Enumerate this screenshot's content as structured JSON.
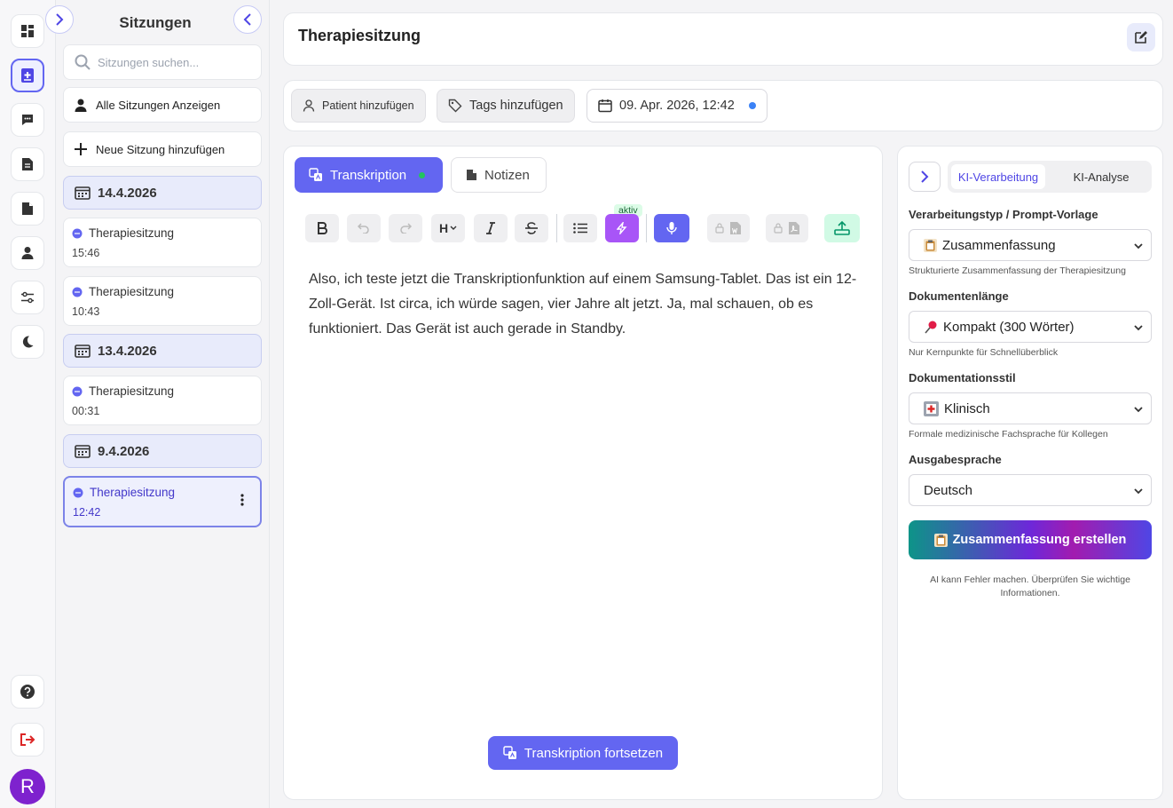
{
  "sidebar": {
    "title": "Sitzungen",
    "search_placeholder": "Sitzungen suchen...",
    "show_all_label": "Alle Sitzungen Anzeigen",
    "add_session_label": "Neue Sitzung hinzufügen",
    "groups": [
      {
        "date": "14.4.2026",
        "items": [
          {
            "title": "Therapiesitzung",
            "time": "15:46"
          },
          {
            "title": "Therapiesitzung",
            "time": "10:43"
          }
        ]
      },
      {
        "date": "13.4.2026",
        "items": [
          {
            "title": "Therapiesitzung",
            "time": "00:31"
          }
        ]
      },
      {
        "date": "9.4.2026",
        "items": [
          {
            "title": "Therapiesitzung",
            "time": "12:42",
            "active": true
          }
        ]
      }
    ]
  },
  "rail": {
    "avatar_letter": "R"
  },
  "header": {
    "title": "Therapiesitzung"
  },
  "meta": {
    "patient_label": "Patient hinzufügen",
    "tags_label": "Tags hinzufügen",
    "date_label": "09. Apr. 2026, 12:42"
  },
  "editor": {
    "tab_transcription": "Transkription",
    "tab_notes": "Notizen",
    "toolbar": {
      "heading_label": "H",
      "aktiv_badge": "aktiv"
    },
    "transcript": "Also, ich teste jetzt die Transkriptionfunktion auf einem Samsung-Tablet. Das ist ein 12-Zoll-Gerät. Ist circa, ich würde sagen, vier Jahre alt jetzt. Ja, mal schauen, ob es funktioniert. Das Gerät ist auch gerade in Standby.",
    "continue_label": "Transkription fortsetzen"
  },
  "ai_panel": {
    "tab_processing": "KI-Verarbeitung",
    "tab_analysis": "KI-Analyse",
    "type_label": "Verarbeitungstyp / Prompt-Vorlage",
    "type_value": "Zusammenfassung",
    "type_help": "Strukturierte Zusammenfassung der Therapiesitzung",
    "length_label": "Dokumentenlänge",
    "length_value": "Kompakt (300 Wörter)",
    "length_help": "Nur Kernpunkte für Schnellüberblick",
    "style_label": "Dokumentationsstil",
    "style_value": "Klinisch",
    "style_help": "Formale medizinische Fachsprache für Kollegen",
    "language_label": "Ausgabesprache",
    "language_value": "Deutsch",
    "create_label": "Zusammenfassung erstellen",
    "disclaimer": "AI kann Fehler machen. Überprüfen Sie wichtige Informationen."
  },
  "colors": {
    "accent": "#6366f1",
    "active_rail": "#4f46e5",
    "avatar": "#7e22ce"
  }
}
